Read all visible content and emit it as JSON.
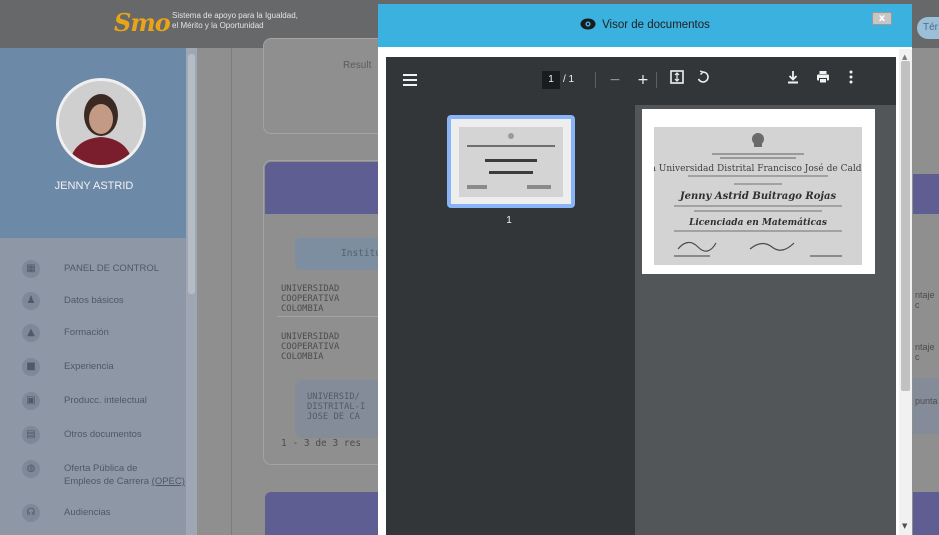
{
  "app": {
    "logo_mark": "Smo",
    "logo_text": "Sistema de apoyo para la Igualdad, el Mérito y la Oportunidad",
    "top_chip": "Tér"
  },
  "profile": {
    "name": "JENNY ASTRID"
  },
  "sidebar": {
    "items": [
      {
        "label": "PANEL DE CONTROL",
        "icon": "dashboard-icon"
      },
      {
        "label": "Datos básicos",
        "icon": "users-icon"
      },
      {
        "label": "Formación",
        "icon": "graduation-cap-icon"
      },
      {
        "label": "Experiencia",
        "icon": "briefcase-icon"
      },
      {
        "label": "Producc. intelectual",
        "icon": "book-icon"
      },
      {
        "label": "Otros documentos",
        "icon": "document-icon"
      },
      {
        "label_line1": "Oferta Pública de",
        "label_line2": "Empleos de Carrera",
        "label_link": "(OPEC)",
        "icon": "globe-icon"
      },
      {
        "label": "Audiencias",
        "icon": "audience-icon"
      }
    ]
  },
  "main": {
    "result_text": "Result",
    "table_header_institution": "Instituc",
    "rows": [
      {
        "institution_line1": "UNIVERSIDAD",
        "institution_line2": "COOPERATIVA",
        "institution_line3": "COLOMBIA",
        "score": "ntaje c"
      },
      {
        "institution_line1": "UNIVERSIDAD",
        "institution_line2": "COOPERATIVA",
        "institution_line3": "COLOMBIA",
        "score": "ntaje c"
      },
      {
        "institution_line1": "UNIVERSID/",
        "institution_line2": "DISTRITAL-I",
        "institution_line3": "JOSE DE CA",
        "score": "punta"
      }
    ],
    "paging": "1 - 3 de 3 res"
  },
  "viewer": {
    "title": "Visor de documentos",
    "close_label": "x",
    "toolbar": {
      "current_page": "1",
      "total_pages": "/ 1",
      "zoom_out": "−",
      "zoom_in": "+",
      "fit_icon": "fit-page-icon",
      "rotate_icon": "rotate-icon",
      "download_icon": "download-icon",
      "print_icon": "print-icon",
      "more_icon": "more-vertical-icon"
    },
    "thumbnail_number": "1",
    "document": {
      "institution": "La Universidad Distrital Francisco José de Caldas",
      "recipient": "Jenny Astrid Buitrago Rojas",
      "degree": "Licenciada en Matemáticas"
    }
  },
  "colors": {
    "viewer_header": "#3ab1de",
    "pdf_toolbar": "#323639",
    "thumb_border": "#8ab4f8",
    "accent_band": "#5f5e92"
  }
}
